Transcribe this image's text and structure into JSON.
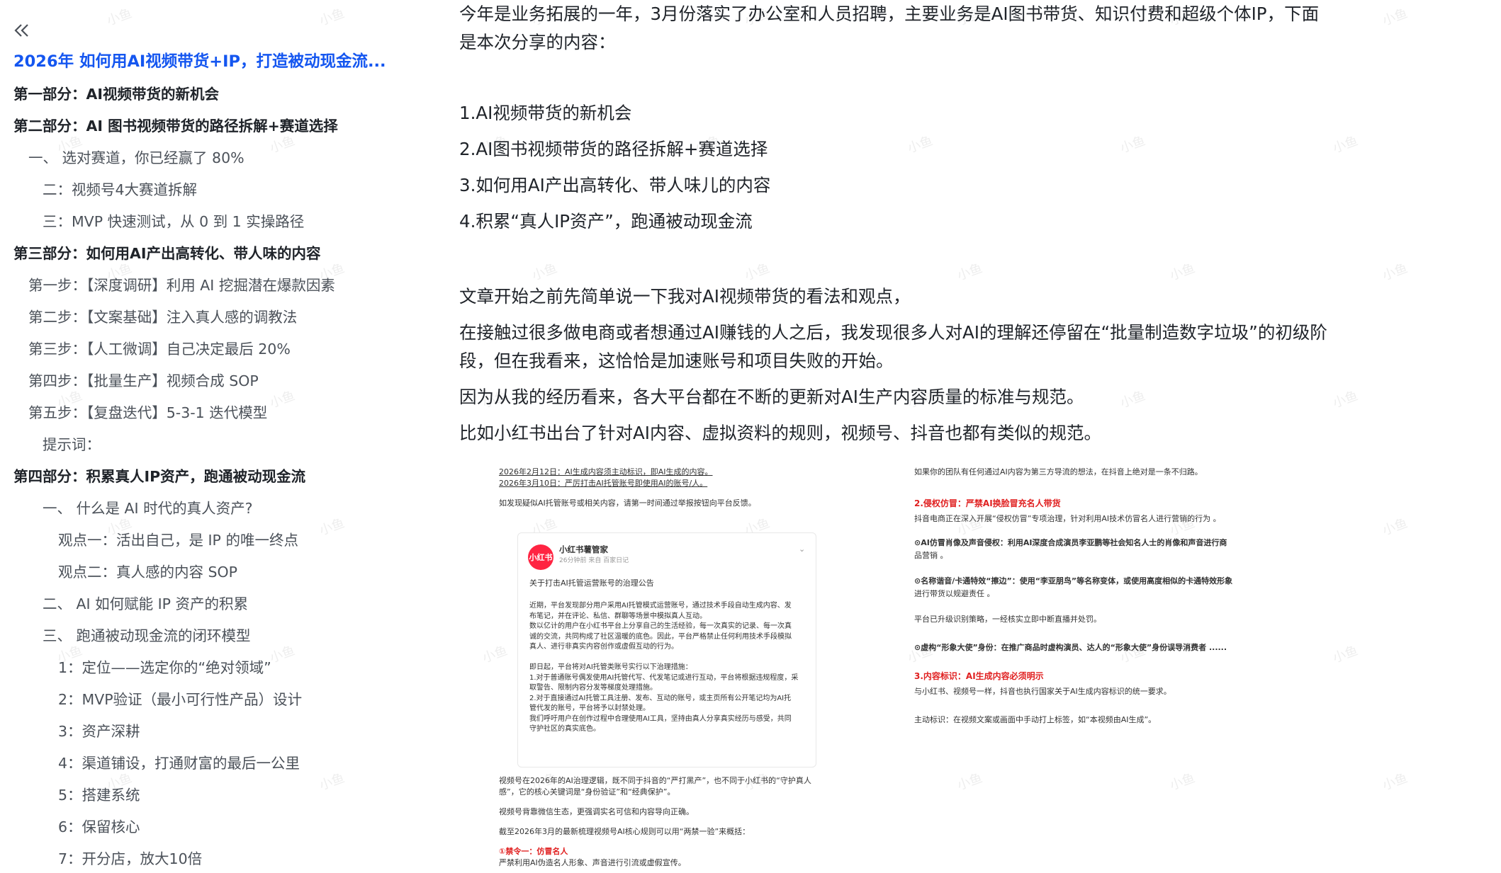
{
  "toc": {
    "collapse_icon": "double-chevron-left-icon",
    "title": "2026年 如何用AI视频带货+IP，打造被动现金流...",
    "items": [
      {
        "text": "第一部分：AI视频带货的新机会",
        "level": "l0"
      },
      {
        "text": "第二部分：AI 图书视频带货的路径拆解+赛道选择",
        "level": "l0"
      },
      {
        "text": "一、 选对赛道，你已经赢了 80%",
        "level": "l1b"
      },
      {
        "text": "二：视频号4大赛道拆解",
        "level": "l1"
      },
      {
        "text": "三：MVP 快速测试，从 0 到 1 实操路径",
        "level": "l1"
      },
      {
        "text": "第三部分：如何用AI产出高转化、带人味的内容",
        "level": "l0"
      },
      {
        "text": "第一步：【深度调研】利用 AI 挖掘潜在爆款因素",
        "level": "l1b"
      },
      {
        "text": "第二步：【文案基础】注入真人感的调教法",
        "level": "l1b"
      },
      {
        "text": "第三步：【人工微调】自己决定最后 20%",
        "level": "l1b"
      },
      {
        "text": "第四步：【批量生产】视频合成 SOP",
        "level": "l1b"
      },
      {
        "text": "第五步：【复盘迭代】5-3-1 迭代模型",
        "level": "l1b"
      },
      {
        "text": "提示词：",
        "level": "l1"
      },
      {
        "text": "第四部分：积累真人IP资产，跑通被动现金流",
        "level": "l0"
      },
      {
        "text": "一、 什么是 AI 时代的真人资产?",
        "level": "l1"
      },
      {
        "text": "观点一：活出自己，是 IP 的唯一终点",
        "level": "l2"
      },
      {
        "text": "观点二：真人感的内容 SOP",
        "level": "l2"
      },
      {
        "text": "二、 AI 如何赋能 IP 资产的积累",
        "level": "l1"
      },
      {
        "text": "三、 跑通被动现金流的闭环模型",
        "level": "l1"
      },
      {
        "text": "1：定位——选定你的“绝对领域”",
        "level": "l2"
      },
      {
        "text": "2：MVP验证（最小可行性产品）设计",
        "level": "l2"
      },
      {
        "text": "3：资产深耕",
        "level": "l2"
      },
      {
        "text": "4：渠道铺设，打通财富的最后一公里",
        "level": "l2"
      },
      {
        "text": "5：搭建系统",
        "level": "l2"
      },
      {
        "text": "6：保留核心",
        "level": "l2"
      },
      {
        "text": "7：开分店，放大10倍",
        "level": "l2"
      }
    ]
  },
  "content": {
    "intro_line1": "今年是业务拓展的一年，3月份落实了办公室和人员招聘，主要业务是AI图书带货、知识付费和超级个体IP，下面",
    "intro_line2": "是本次分享的内容：",
    "list": [
      "1.AI视频带货的新机会",
      "2.AI图书视频带货的路径拆解+赛道选择",
      "3.如何用AI产出高转化、带人味儿的内容",
      "4.积累“真人IP资产”，跑通被动现金流"
    ],
    "p1": "文章开始之前先简单说一下我对AI视频带货的看法和观点，",
    "p2_line1": "在接触过很多做电商或者想通过AI赚钱的人之后，我发现很多人对AI的理解还停留在“批量制造数字垃圾”的初级阶",
    "p2_line2": "段，但在我看来，这恰恰是加速账号和项目失败的开始。",
    "p3": "因为从我的经历看来，各大平台都在不断的更新对AI生产内容质量的标准与规范。",
    "p4": "比如小红书出台了针对AI内容、虚拟资料的规则，视频号、抖音也都有类似的规范。"
  },
  "image_left": {
    "line1": "2026年2月12日：AI生成内容须主动标识，即AI生成的内容。",
    "line2": "2026年3月10日：严厉打击AI托管账号即使用AI的账号/人。",
    "line3": "如发现疑似AI托管账号或相关内容，请第一时间通过举报按钮向平台反馈。",
    "card_logo": "小红书",
    "card_name": "小红书薯管家",
    "card_meta": "26分钟前 来自 百家日记",
    "card_title": "关于打击AI托管运营账号的治理公告",
    "card_body": [
      "近期，平台发现部分用户采用AI托管模式运营账号，通过技术手段自动生成内容、发",
      "布笔记，并在评论、私信、群聊等场景中模拟真人互动。",
      "数以亿计的用户在小红书平台上分享自己的生活经验，每一次真实的记录、每一次真",
      "诚的交流，共同构成了社区温暖的底色。因此，平台严格禁止任何利用技术手段模拟",
      "真人、进行非真实内容创作或虚假互动的行为。",
      "",
      "即日起，平台将对AI托管类账号实行以下治理措施：",
      "1.对于普通账号偶发使用AI托管代写、代发笔记或进行互动，平台将根据违规程度，采",
      "取警告、限制内容分发等梯度处理措施。",
      "2.对于直接通过AI托管工具注册、发布、互动的账号，或主页所有公开笔记均为AI托",
      "管代发的账号，平台将予以封禁处理。",
      "我们呼吁用户在创作过程中合理使用AI工具，坚持由真人分享真实经历与感受，共同",
      "守护社区的真实底色。"
    ],
    "after1": "视频号在2026年的AI治理逻辑，既不同于抖音的“严打黑产”，也不同于小红书的“守护真人",
    "after2": "感”，它的核心关键词是“身份验证”和“经典保护”。",
    "after3": "视频号背靠微信生态，更强调实名可信和内容导向正确。",
    "after4": "截至2026年3月的最新梳理视频号AI核心规则可以用“两禁一验”来概括：",
    "after5": "①禁令一：仿冒名人",
    "after6": "严禁利用AI伪造名人形象、声音进行引流或虚假宣传。"
  },
  "image_right": {
    "line1": "如果你的团队有任何通过AI内容为第三方导流的想法，在抖音上绝对是一条不归路。",
    "h2": "2.侵权仿冒：严禁AI换脸冒充名人带货",
    "l2a": "抖音电商正在深入开展“侵权仿冒”专项治理，针对利用AI技术仿冒名人进行营销的行为 。",
    "l3": "⊙AI仿冒肖像及声音侵权：利用AI深度合成演员李亚鹏等社会知名人士的肖像和声音进行商",
    "l3b": "品营销 。",
    "l4": "⊙名称谐音/卡通特效“擦边”：使用“李亚朋鸟”等名称变体，或使用高度相似的卡通特效形象",
    "l4b": "进行带货以规避责任 。",
    "l5": "平台已升级识别策略，一经核实立即中断直播并处罚。",
    "l6": "⊙虚构“形象大使”身份：在推广商品时虚构演员、达人的“形象大使”身份误导消费者 ......",
    "h3": "3.内容标识：AI生成内容必须明示",
    "l7": "与小红书、视频号一样，抖音也执行国家关于AI生成内容标识的统一要求。",
    "l8": "主动标识：在视频文案或画面中手动打上标签，如“本视频由AI生成”。"
  },
  "watermark_text": "小鱼"
}
